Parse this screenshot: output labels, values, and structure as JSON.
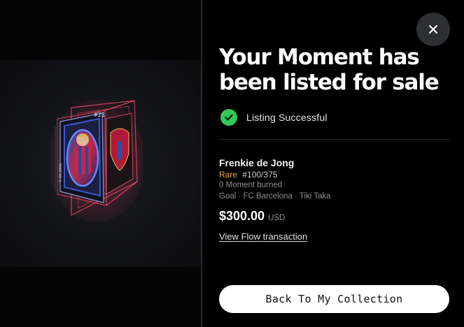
{
  "modal": {
    "title": "Your Moment has been listed for sale",
    "status": {
      "text": "Listing Successful",
      "icon": "check-circle-icon",
      "color": "#34c759"
    },
    "moment": {
      "player": "Frenkie de Jong",
      "rarity": "Rare",
      "rarity_color": "#e9a93b",
      "serial": "#100/375",
      "burned": "0 Moment burned",
      "details": "Goal · FC Barcelona · Tiki Taka",
      "jersey_number": "#21",
      "card_player_text": "F. DE JONG"
    },
    "price": {
      "amount": "$300.00",
      "currency": "USD"
    },
    "link_label": "View Flow transaction",
    "back_button_label": "Back To My Collection",
    "close_icon": "close-icon"
  }
}
